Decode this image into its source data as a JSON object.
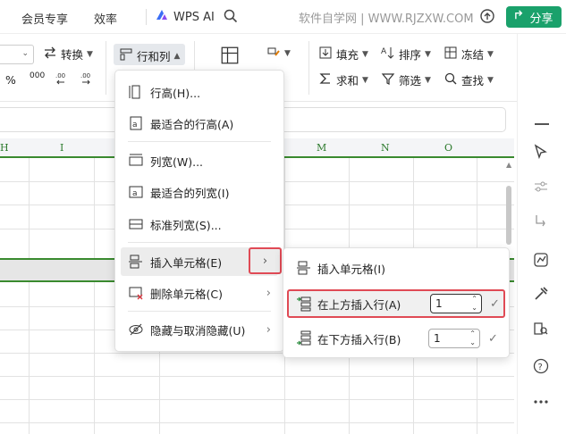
{
  "topbar": {
    "menu": [
      "会员专享",
      "效率"
    ],
    "wps_ai": "WPS AI",
    "site": "软件自学网 | WWW.RJZXW.COM",
    "share": "分享"
  },
  "ribbon": {
    "convert": "转换",
    "rowcol": "行和列",
    "fill": "填充",
    "sort": "排序",
    "freeze": "冻结",
    "sum": "求和",
    "filter": "筛选",
    "find": "查找",
    "percent": "%",
    "thousands": "000"
  },
  "grid": {
    "columns": [
      "H",
      "I",
      "M",
      "N",
      "O"
    ]
  },
  "menu": {
    "row_height": "行高(H)...",
    "best_row_height": "最适合的行高(A)",
    "col_width": "列宽(W)...",
    "best_col_width": "最适合的列宽(I)",
    "std_col_width": "标准列宽(S)...",
    "insert_cells": "插入单元格(E)",
    "delete_cells": "删除单元格(C)",
    "hide_unhide": "隐藏与取消隐藏(U)"
  },
  "submenu": {
    "insert_cells": "插入单元格(I)",
    "insert_above": "在上方插入行(A)",
    "insert_above_count": "1",
    "insert_below": "在下方插入行(B)",
    "insert_below_count": "1"
  },
  "colors": {
    "accent": "#1aa16b",
    "header_line": "#3a8a2f",
    "highlight_border": "#e04a55"
  }
}
